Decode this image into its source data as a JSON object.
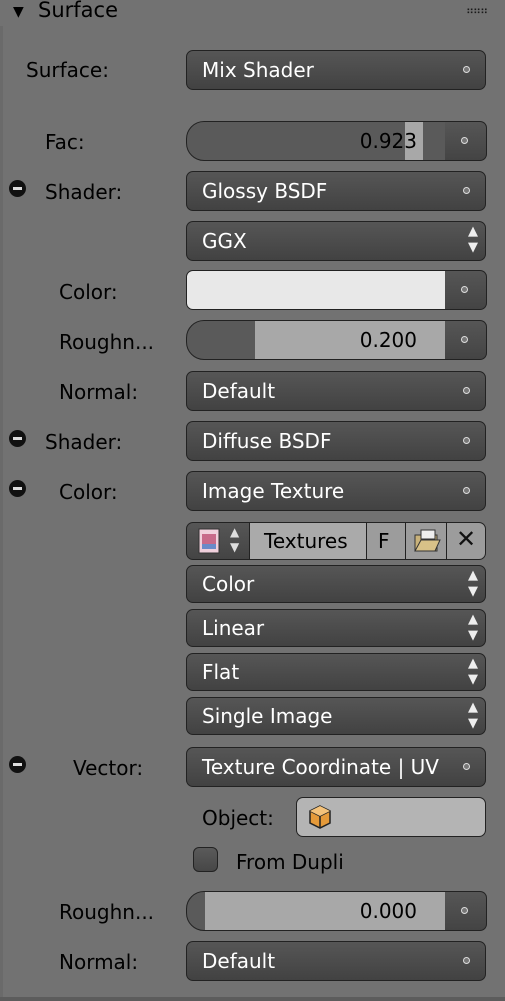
{
  "panel": {
    "title": "Surface",
    "collapse_icon": "triangle-down-icon",
    "grip_icon": "drag-grip-icon"
  },
  "surface": {
    "label": "Surface:",
    "value": "Mix Shader"
  },
  "fac": {
    "label": "Fac:",
    "value": "0.923",
    "fraction": 0.923
  },
  "shader1": {
    "label": "Shader:",
    "value": "Glossy BSDF",
    "distribution": "GGX"
  },
  "glossy_color": {
    "label": "Color:",
    "color": "#e8e8e8"
  },
  "glossy_roughness": {
    "label": "Roughn...",
    "value": "0.200",
    "fraction": 0.2
  },
  "glossy_normal": {
    "label": "Normal:",
    "value": "Default"
  },
  "shader2": {
    "label": "Shader:",
    "value": "Diffuse BSDF"
  },
  "diffuse_color": {
    "label": "Color:",
    "value": "Image Texture"
  },
  "image_block": {
    "image_name": "Textures",
    "fake_user": "F"
  },
  "dropdowns": [
    "Color",
    "Linear",
    "Flat",
    "Single Image"
  ],
  "vector": {
    "label": "Vector:",
    "value": "Texture Coordinate | UV"
  },
  "object": {
    "label": "Object:",
    "value": ""
  },
  "from_dupli": {
    "label": "From Dupli",
    "checked": false
  },
  "diffuse_roughness": {
    "label": "Roughn...",
    "value": "0.000",
    "fraction": 0.0
  },
  "diffuse_normal": {
    "label": "Normal:",
    "value": "Default"
  }
}
